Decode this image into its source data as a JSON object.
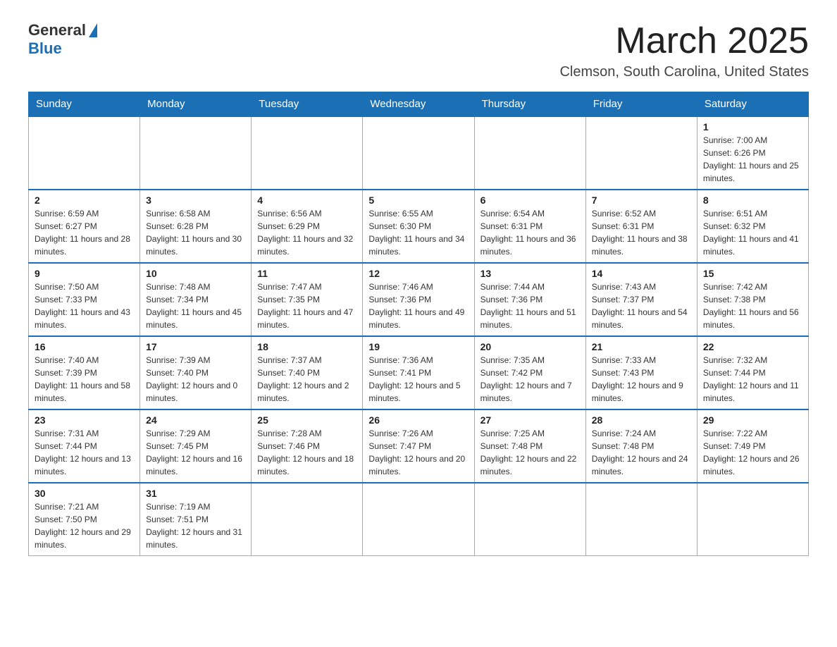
{
  "header": {
    "logo_general": "General",
    "logo_blue": "Blue",
    "month_title": "March 2025",
    "location": "Clemson, South Carolina, United States"
  },
  "weekdays": [
    "Sunday",
    "Monday",
    "Tuesday",
    "Wednesday",
    "Thursday",
    "Friday",
    "Saturday"
  ],
  "weeks": [
    [
      {
        "day": "",
        "sunrise": "",
        "sunset": "",
        "daylight": ""
      },
      {
        "day": "",
        "sunrise": "",
        "sunset": "",
        "daylight": ""
      },
      {
        "day": "",
        "sunrise": "",
        "sunset": "",
        "daylight": ""
      },
      {
        "day": "",
        "sunrise": "",
        "sunset": "",
        "daylight": ""
      },
      {
        "day": "",
        "sunrise": "",
        "sunset": "",
        "daylight": ""
      },
      {
        "day": "",
        "sunrise": "",
        "sunset": "",
        "daylight": ""
      },
      {
        "day": "1",
        "sunrise": "Sunrise: 7:00 AM",
        "sunset": "Sunset: 6:26 PM",
        "daylight": "Daylight: 11 hours and 25 minutes."
      }
    ],
    [
      {
        "day": "2",
        "sunrise": "Sunrise: 6:59 AM",
        "sunset": "Sunset: 6:27 PM",
        "daylight": "Daylight: 11 hours and 28 minutes."
      },
      {
        "day": "3",
        "sunrise": "Sunrise: 6:58 AM",
        "sunset": "Sunset: 6:28 PM",
        "daylight": "Daylight: 11 hours and 30 minutes."
      },
      {
        "day": "4",
        "sunrise": "Sunrise: 6:56 AM",
        "sunset": "Sunset: 6:29 PM",
        "daylight": "Daylight: 11 hours and 32 minutes."
      },
      {
        "day": "5",
        "sunrise": "Sunrise: 6:55 AM",
        "sunset": "Sunset: 6:30 PM",
        "daylight": "Daylight: 11 hours and 34 minutes."
      },
      {
        "day": "6",
        "sunrise": "Sunrise: 6:54 AM",
        "sunset": "Sunset: 6:31 PM",
        "daylight": "Daylight: 11 hours and 36 minutes."
      },
      {
        "day": "7",
        "sunrise": "Sunrise: 6:52 AM",
        "sunset": "Sunset: 6:31 PM",
        "daylight": "Daylight: 11 hours and 38 minutes."
      },
      {
        "day": "8",
        "sunrise": "Sunrise: 6:51 AM",
        "sunset": "Sunset: 6:32 PM",
        "daylight": "Daylight: 11 hours and 41 minutes."
      }
    ],
    [
      {
        "day": "9",
        "sunrise": "Sunrise: 7:50 AM",
        "sunset": "Sunset: 7:33 PM",
        "daylight": "Daylight: 11 hours and 43 minutes."
      },
      {
        "day": "10",
        "sunrise": "Sunrise: 7:48 AM",
        "sunset": "Sunset: 7:34 PM",
        "daylight": "Daylight: 11 hours and 45 minutes."
      },
      {
        "day": "11",
        "sunrise": "Sunrise: 7:47 AM",
        "sunset": "Sunset: 7:35 PM",
        "daylight": "Daylight: 11 hours and 47 minutes."
      },
      {
        "day": "12",
        "sunrise": "Sunrise: 7:46 AM",
        "sunset": "Sunset: 7:36 PM",
        "daylight": "Daylight: 11 hours and 49 minutes."
      },
      {
        "day": "13",
        "sunrise": "Sunrise: 7:44 AM",
        "sunset": "Sunset: 7:36 PM",
        "daylight": "Daylight: 11 hours and 51 minutes."
      },
      {
        "day": "14",
        "sunrise": "Sunrise: 7:43 AM",
        "sunset": "Sunset: 7:37 PM",
        "daylight": "Daylight: 11 hours and 54 minutes."
      },
      {
        "day": "15",
        "sunrise": "Sunrise: 7:42 AM",
        "sunset": "Sunset: 7:38 PM",
        "daylight": "Daylight: 11 hours and 56 minutes."
      }
    ],
    [
      {
        "day": "16",
        "sunrise": "Sunrise: 7:40 AM",
        "sunset": "Sunset: 7:39 PM",
        "daylight": "Daylight: 11 hours and 58 minutes."
      },
      {
        "day": "17",
        "sunrise": "Sunrise: 7:39 AM",
        "sunset": "Sunset: 7:40 PM",
        "daylight": "Daylight: 12 hours and 0 minutes."
      },
      {
        "day": "18",
        "sunrise": "Sunrise: 7:37 AM",
        "sunset": "Sunset: 7:40 PM",
        "daylight": "Daylight: 12 hours and 2 minutes."
      },
      {
        "day": "19",
        "sunrise": "Sunrise: 7:36 AM",
        "sunset": "Sunset: 7:41 PM",
        "daylight": "Daylight: 12 hours and 5 minutes."
      },
      {
        "day": "20",
        "sunrise": "Sunrise: 7:35 AM",
        "sunset": "Sunset: 7:42 PM",
        "daylight": "Daylight: 12 hours and 7 minutes."
      },
      {
        "day": "21",
        "sunrise": "Sunrise: 7:33 AM",
        "sunset": "Sunset: 7:43 PM",
        "daylight": "Daylight: 12 hours and 9 minutes."
      },
      {
        "day": "22",
        "sunrise": "Sunrise: 7:32 AM",
        "sunset": "Sunset: 7:44 PM",
        "daylight": "Daylight: 12 hours and 11 minutes."
      }
    ],
    [
      {
        "day": "23",
        "sunrise": "Sunrise: 7:31 AM",
        "sunset": "Sunset: 7:44 PM",
        "daylight": "Daylight: 12 hours and 13 minutes."
      },
      {
        "day": "24",
        "sunrise": "Sunrise: 7:29 AM",
        "sunset": "Sunset: 7:45 PM",
        "daylight": "Daylight: 12 hours and 16 minutes."
      },
      {
        "day": "25",
        "sunrise": "Sunrise: 7:28 AM",
        "sunset": "Sunset: 7:46 PM",
        "daylight": "Daylight: 12 hours and 18 minutes."
      },
      {
        "day": "26",
        "sunrise": "Sunrise: 7:26 AM",
        "sunset": "Sunset: 7:47 PM",
        "daylight": "Daylight: 12 hours and 20 minutes."
      },
      {
        "day": "27",
        "sunrise": "Sunrise: 7:25 AM",
        "sunset": "Sunset: 7:48 PM",
        "daylight": "Daylight: 12 hours and 22 minutes."
      },
      {
        "day": "28",
        "sunrise": "Sunrise: 7:24 AM",
        "sunset": "Sunset: 7:48 PM",
        "daylight": "Daylight: 12 hours and 24 minutes."
      },
      {
        "day": "29",
        "sunrise": "Sunrise: 7:22 AM",
        "sunset": "Sunset: 7:49 PM",
        "daylight": "Daylight: 12 hours and 26 minutes."
      }
    ],
    [
      {
        "day": "30",
        "sunrise": "Sunrise: 7:21 AM",
        "sunset": "Sunset: 7:50 PM",
        "daylight": "Daylight: 12 hours and 29 minutes."
      },
      {
        "day": "31",
        "sunrise": "Sunrise: 7:19 AM",
        "sunset": "Sunset: 7:51 PM",
        "daylight": "Daylight: 12 hours and 31 minutes."
      },
      {
        "day": "",
        "sunrise": "",
        "sunset": "",
        "daylight": ""
      },
      {
        "day": "",
        "sunrise": "",
        "sunset": "",
        "daylight": ""
      },
      {
        "day": "",
        "sunrise": "",
        "sunset": "",
        "daylight": ""
      },
      {
        "day": "",
        "sunrise": "",
        "sunset": "",
        "daylight": ""
      },
      {
        "day": "",
        "sunrise": "",
        "sunset": "",
        "daylight": ""
      }
    ]
  ]
}
